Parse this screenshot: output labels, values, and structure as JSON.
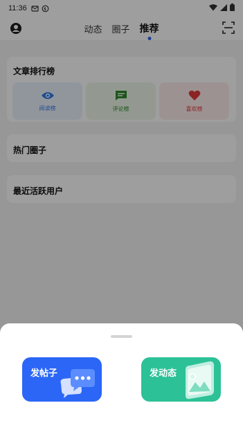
{
  "status_bar": {
    "time": "11:36"
  },
  "tabs": [
    {
      "label": "动态"
    },
    {
      "label": "圈子"
    },
    {
      "label": "推荐"
    }
  ],
  "ranking": {
    "title": "文章排行榜",
    "items": [
      {
        "label": "阅读榜",
        "icon": "eye-icon",
        "color": "#2f7be8"
      },
      {
        "label": "评论榜",
        "icon": "comment-icon",
        "color": "#2f8a2e"
      },
      {
        "label": "喜欢榜",
        "icon": "heart-icon",
        "color": "#e03a3a"
      }
    ]
  },
  "hot_circles": {
    "title": "热门圈子"
  },
  "active_users": {
    "title": "最近活跃用户"
  },
  "sheet": {
    "post": {
      "label": "发帖子",
      "color": "#2b66f6"
    },
    "moment": {
      "label": "发动态",
      "color": "#2cc197"
    }
  }
}
